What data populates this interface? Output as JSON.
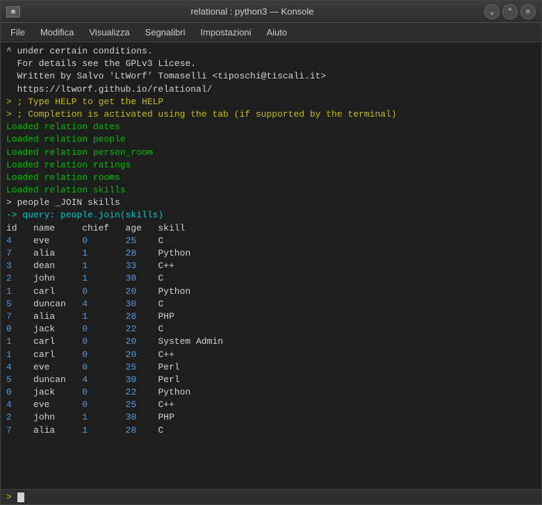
{
  "window": {
    "title": "relational : python3 — Konsole",
    "icon_text": "▣"
  },
  "menu": {
    "items": [
      "File",
      "Modifica",
      "Visualizza",
      "Segnalibri",
      "Impostazioni",
      "Aiuto"
    ]
  },
  "terminal": {
    "lines": [
      {
        "text": "^ under certain conditions.",
        "color": "white"
      },
      {
        "text": "  For details see the GPLv3 Licese.",
        "color": "white"
      },
      {
        "text": "",
        "color": "white"
      },
      {
        "text": "  Written by Salvo 'LtWorf' Tomaselli <tiposchi@tiscali.it>",
        "color": "white"
      },
      {
        "text": "",
        "color": "white"
      },
      {
        "text": "  https://ltworf.github.io/relational/",
        "color": "white"
      },
      {
        "text": "> ; Type HELP to get the HELP",
        "color": "yellow"
      },
      {
        "text": "> ; Completion is activated using the tab (if supported by the terminal)",
        "color": "yellow"
      },
      {
        "text": "Loaded relation dates",
        "color": "loaded"
      },
      {
        "text": "Loaded relation people",
        "color": "loaded"
      },
      {
        "text": "Loaded relation person_room",
        "color": "loaded"
      },
      {
        "text": "Loaded relation ratings",
        "color": "loaded"
      },
      {
        "text": "Loaded relation rooms",
        "color": "loaded"
      },
      {
        "text": "Loaded relation skills",
        "color": "loaded"
      },
      {
        "text": "> people _JOIN skills",
        "color": "white"
      },
      {
        "text": "-> query: people.join(skills)",
        "color": "query"
      },
      {
        "text": "",
        "color": "white"
      },
      {
        "text": "id   name     chief   age   skill",
        "color": "white"
      },
      {
        "text": "4    eve      0       25    C",
        "color": "mixed",
        "parts": [
          {
            "text": "4",
            "color": "number"
          },
          {
            "text": "    eve      ",
            "color": "white"
          },
          {
            "text": "0",
            "color": "number"
          },
          {
            "text": "       ",
            "color": "white"
          },
          {
            "text": "25",
            "color": "number"
          },
          {
            "text": "    C",
            "color": "white"
          }
        ]
      },
      {
        "text": "7    alia     1       28    Python",
        "color": "mixed",
        "parts": [
          {
            "text": "7",
            "color": "number"
          },
          {
            "text": "    alia     ",
            "color": "white"
          },
          {
            "text": "1",
            "color": "number"
          },
          {
            "text": "       ",
            "color": "white"
          },
          {
            "text": "28",
            "color": "number"
          },
          {
            "text": "    Python",
            "color": "white"
          }
        ]
      },
      {
        "text": "3    dean     1       33    C++",
        "color": "mixed",
        "parts": [
          {
            "text": "3",
            "color": "number"
          },
          {
            "text": "    dean     ",
            "color": "white"
          },
          {
            "text": "1",
            "color": "number"
          },
          {
            "text": "       ",
            "color": "white"
          },
          {
            "text": "33",
            "color": "number"
          },
          {
            "text": "    C++",
            "color": "white"
          }
        ]
      },
      {
        "text": "2    john     1       30    C",
        "color": "mixed",
        "parts": [
          {
            "text": "2",
            "color": "number"
          },
          {
            "text": "    john     ",
            "color": "white"
          },
          {
            "text": "1",
            "color": "number"
          },
          {
            "text": "       ",
            "color": "white"
          },
          {
            "text": "30",
            "color": "number"
          },
          {
            "text": "    C",
            "color": "white"
          }
        ]
      },
      {
        "text": "1    carl     0       20    Python",
        "color": "mixed",
        "parts": [
          {
            "text": "1",
            "color": "number"
          },
          {
            "text": "    carl     ",
            "color": "white"
          },
          {
            "text": "0",
            "color": "number"
          },
          {
            "text": "       ",
            "color": "white"
          },
          {
            "text": "20",
            "color": "number"
          },
          {
            "text": "    Python",
            "color": "white"
          }
        ]
      },
      {
        "text": "5    duncan   4       30    C",
        "color": "mixed",
        "parts": [
          {
            "text": "5",
            "color": "number"
          },
          {
            "text": "    duncan   ",
            "color": "white"
          },
          {
            "text": "4",
            "color": "number"
          },
          {
            "text": "       ",
            "color": "white"
          },
          {
            "text": "30",
            "color": "number"
          },
          {
            "text": "    C",
            "color": "white"
          }
        ]
      },
      {
        "text": "7    alia     1       28    PHP",
        "color": "mixed",
        "parts": [
          {
            "text": "7",
            "color": "number"
          },
          {
            "text": "    alia     ",
            "color": "white"
          },
          {
            "text": "1",
            "color": "number"
          },
          {
            "text": "       ",
            "color": "white"
          },
          {
            "text": "28",
            "color": "number"
          },
          {
            "text": "    PHP",
            "color": "white"
          }
        ]
      },
      {
        "text": "0    jack     0       22    C",
        "color": "mixed",
        "parts": [
          {
            "text": "0",
            "color": "number"
          },
          {
            "text": "    jack     ",
            "color": "white"
          },
          {
            "text": "0",
            "color": "number"
          },
          {
            "text": "       ",
            "color": "white"
          },
          {
            "text": "22",
            "color": "number"
          },
          {
            "text": "    C",
            "color": "white"
          }
        ]
      },
      {
        "text": "1    carl     0       20    System Admin",
        "color": "mixed",
        "parts": [
          {
            "text": "1",
            "color": "number"
          },
          {
            "text": "    carl     ",
            "color": "white"
          },
          {
            "text": "0",
            "color": "number"
          },
          {
            "text": "       ",
            "color": "white"
          },
          {
            "text": "20",
            "color": "number"
          },
          {
            "text": "    System Admin",
            "color": "white"
          }
        ]
      },
      {
        "text": "1    carl     0       20    C++",
        "color": "mixed",
        "parts": [
          {
            "text": "1",
            "color": "number"
          },
          {
            "text": "    carl     ",
            "color": "white"
          },
          {
            "text": "0",
            "color": "number"
          },
          {
            "text": "       ",
            "color": "white"
          },
          {
            "text": "20",
            "color": "number"
          },
          {
            "text": "    C++",
            "color": "white"
          }
        ]
      },
      {
        "text": "4    eve      0       25    Perl",
        "color": "mixed",
        "parts": [
          {
            "text": "4",
            "color": "number"
          },
          {
            "text": "    eve      ",
            "color": "white"
          },
          {
            "text": "0",
            "color": "number"
          },
          {
            "text": "       ",
            "color": "white"
          },
          {
            "text": "25",
            "color": "number"
          },
          {
            "text": "    Perl",
            "color": "white"
          }
        ]
      },
      {
        "text": "5    duncan   4       30    Perl",
        "color": "mixed",
        "parts": [
          {
            "text": "5",
            "color": "number"
          },
          {
            "text": "    duncan   ",
            "color": "white"
          },
          {
            "text": "4",
            "color": "number"
          },
          {
            "text": "       ",
            "color": "white"
          },
          {
            "text": "30",
            "color": "number"
          },
          {
            "text": "    Perl",
            "color": "white"
          }
        ]
      },
      {
        "text": "0    jack     0       22    Python",
        "color": "mixed",
        "parts": [
          {
            "text": "0",
            "color": "number"
          },
          {
            "text": "    jack     ",
            "color": "white"
          },
          {
            "text": "0",
            "color": "number"
          },
          {
            "text": "       ",
            "color": "white"
          },
          {
            "text": "22",
            "color": "number"
          },
          {
            "text": "    Python",
            "color": "white"
          }
        ]
      },
      {
        "text": "4    eve      0       25    C++",
        "color": "mixed",
        "parts": [
          {
            "text": "4",
            "color": "number"
          },
          {
            "text": "    eve      ",
            "color": "white"
          },
          {
            "text": "0",
            "color": "number"
          },
          {
            "text": "       ",
            "color": "white"
          },
          {
            "text": "25",
            "color": "number"
          },
          {
            "text": "    C++",
            "color": "white"
          }
        ]
      },
      {
        "text": "2    john     1       30    PHP",
        "color": "mixed",
        "parts": [
          {
            "text": "2",
            "color": "number"
          },
          {
            "text": "    john     ",
            "color": "white"
          },
          {
            "text": "1",
            "color": "number"
          },
          {
            "text": "       ",
            "color": "white"
          },
          {
            "text": "30",
            "color": "number"
          },
          {
            "text": "    PHP",
            "color": "white"
          }
        ]
      },
      {
        "text": "7    alia     1       28    C",
        "color": "mixed",
        "parts": [
          {
            "text": "7",
            "color": "number"
          },
          {
            "text": "    alia     ",
            "color": "white"
          },
          {
            "text": "1",
            "color": "number"
          },
          {
            "text": "       ",
            "color": "white"
          },
          {
            "text": "28",
            "color": "number"
          },
          {
            "text": "    C",
            "color": "white"
          }
        ]
      }
    ]
  },
  "bottom": {
    "prompt": "> "
  },
  "colors": {
    "yellow": "#c8c000",
    "green": "#00c000",
    "blue": "#5b9bd5",
    "cyan": "#00c8c8",
    "white": "#d3d3d3",
    "bg": "#1e1e1e"
  }
}
